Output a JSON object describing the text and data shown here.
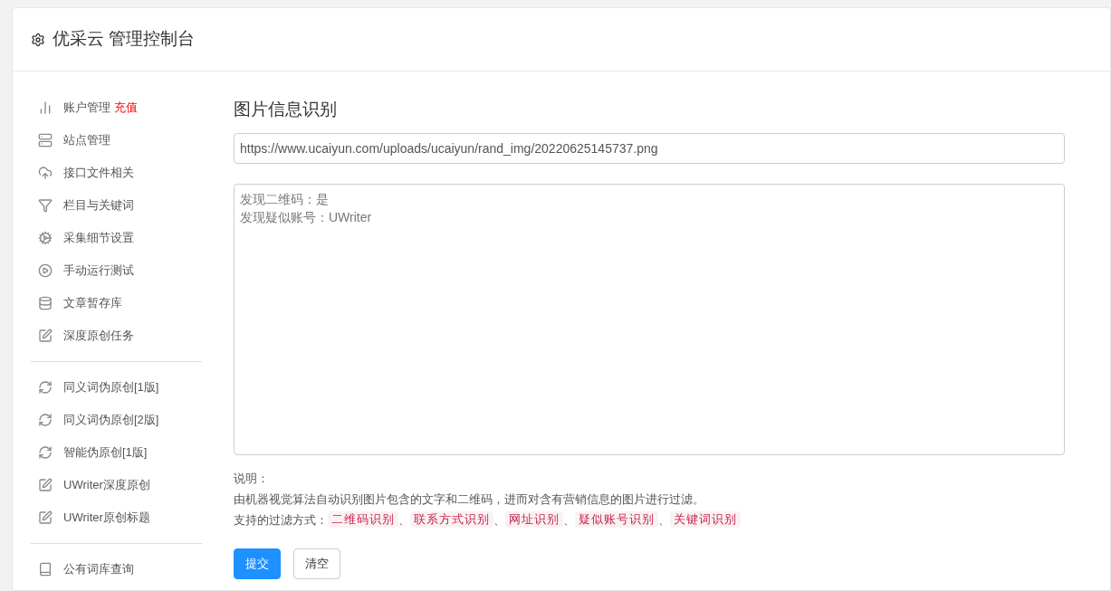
{
  "header": {
    "title": "优采云 管理控制台"
  },
  "sidebar": {
    "groups": [
      {
        "items": [
          {
            "label": "账户管理",
            "badge": "充值"
          },
          {
            "label": "站点管理"
          },
          {
            "label": "接口文件相关"
          },
          {
            "label": "栏目与关键词"
          },
          {
            "label": "采集细节设置"
          },
          {
            "label": "手动运行测试"
          },
          {
            "label": "文章暂存库"
          },
          {
            "label": "深度原创任务"
          }
        ]
      },
      {
        "items": [
          {
            "label": "同义词伪原创[1版]"
          },
          {
            "label": "同义词伪原创[2版]"
          },
          {
            "label": "智能伪原创[1版]"
          },
          {
            "label": "UWriter深度原创"
          },
          {
            "label": "UWriter原创标题"
          }
        ]
      },
      {
        "items": [
          {
            "label": "公有词库查询"
          }
        ]
      }
    ]
  },
  "main": {
    "title": "图片信息识别",
    "url_field": {
      "value": "https://www.ucaiyun.com/uploads/ucaiyun/rand_img/20220625145737.png"
    },
    "result_box": {
      "lines": [
        "发现二维码：是",
        "发现疑似账号：UWriter"
      ]
    },
    "notes": {
      "heading": "说明：",
      "description": "由机器视觉算法自动识别图片包含的文字和二维码，进而对含有营销信息的图片进行过滤。",
      "filters_label": "支持的过滤方式：",
      "separator": "、",
      "tags": [
        "二维码识别",
        "联系方式识别",
        "网址识别",
        "疑似账号识别",
        "关键词识别"
      ]
    },
    "buttons": [
      {
        "label": "提交",
        "kind": "primary"
      },
      {
        "label": "清空",
        "kind": "default"
      }
    ]
  }
}
